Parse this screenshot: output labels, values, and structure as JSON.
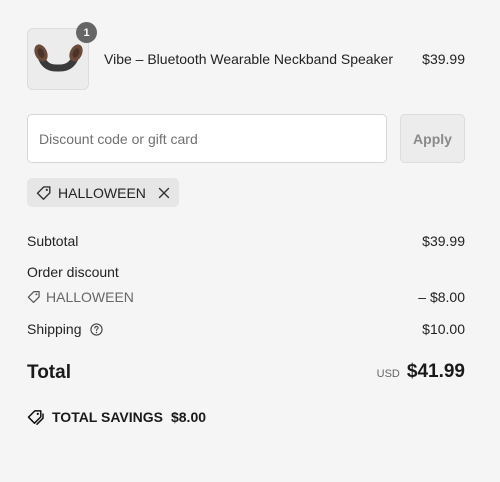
{
  "product": {
    "quantity": "1",
    "name": "Vibe – Bluetooth Wearable Neckband Speaker",
    "price": "$39.99"
  },
  "discount": {
    "placeholder": "Discount code or gift card",
    "value": "",
    "apply_label": "Apply"
  },
  "applied_code": "HALLOWEEN",
  "summary": {
    "subtotal_label": "Subtotal",
    "subtotal_value": "$39.99",
    "order_discount_label": "Order discount",
    "discount_code": "HALLOWEEN",
    "discount_value": "– $8.00",
    "shipping_label": "Shipping",
    "shipping_value": "$10.00",
    "total_label": "Total",
    "currency": "USD",
    "total_value": "$41.99",
    "savings_label": "TOTAL SAVINGS",
    "savings_value": "$8.00"
  },
  "icons": {
    "tag": "tag-icon",
    "remove": "close-icon",
    "info": "question-circle-icon",
    "savings": "double-tag-icon"
  }
}
